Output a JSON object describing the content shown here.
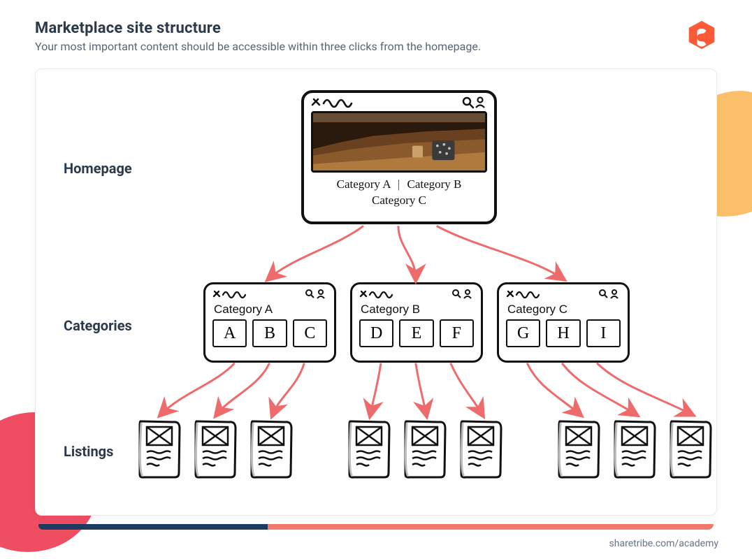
{
  "header": {
    "title": "Marketplace site structure",
    "subtitle": "Your most important content should be accessible within three clicks from the homepage."
  },
  "labels": {
    "homepage": "Homepage",
    "categories": "Categories",
    "listings": "Listings"
  },
  "homepage_mock": {
    "categories_line1_a": "Category A",
    "categories_line1_b": "Category B",
    "categories_line2": "Category C"
  },
  "category_pages": [
    {
      "title": "Category A",
      "thumbs": [
        "A",
        "B",
        "C"
      ]
    },
    {
      "title": "Category B",
      "thumbs": [
        "D",
        "E",
        "F"
      ]
    },
    {
      "title": "Category C",
      "thumbs": [
        "G",
        "H",
        "I"
      ]
    }
  ],
  "listing_rows": [
    3,
    3,
    3
  ],
  "footer_link": "sharetribe.com/academy",
  "colors": {
    "arrow": "#ef6a6a",
    "blob_orange": "#fbbf6a",
    "blob_red": "#ee4d62",
    "stripe_navy": "#1d3b61",
    "stripe_coral": "#f0796c",
    "brand": "#fa5a36"
  }
}
